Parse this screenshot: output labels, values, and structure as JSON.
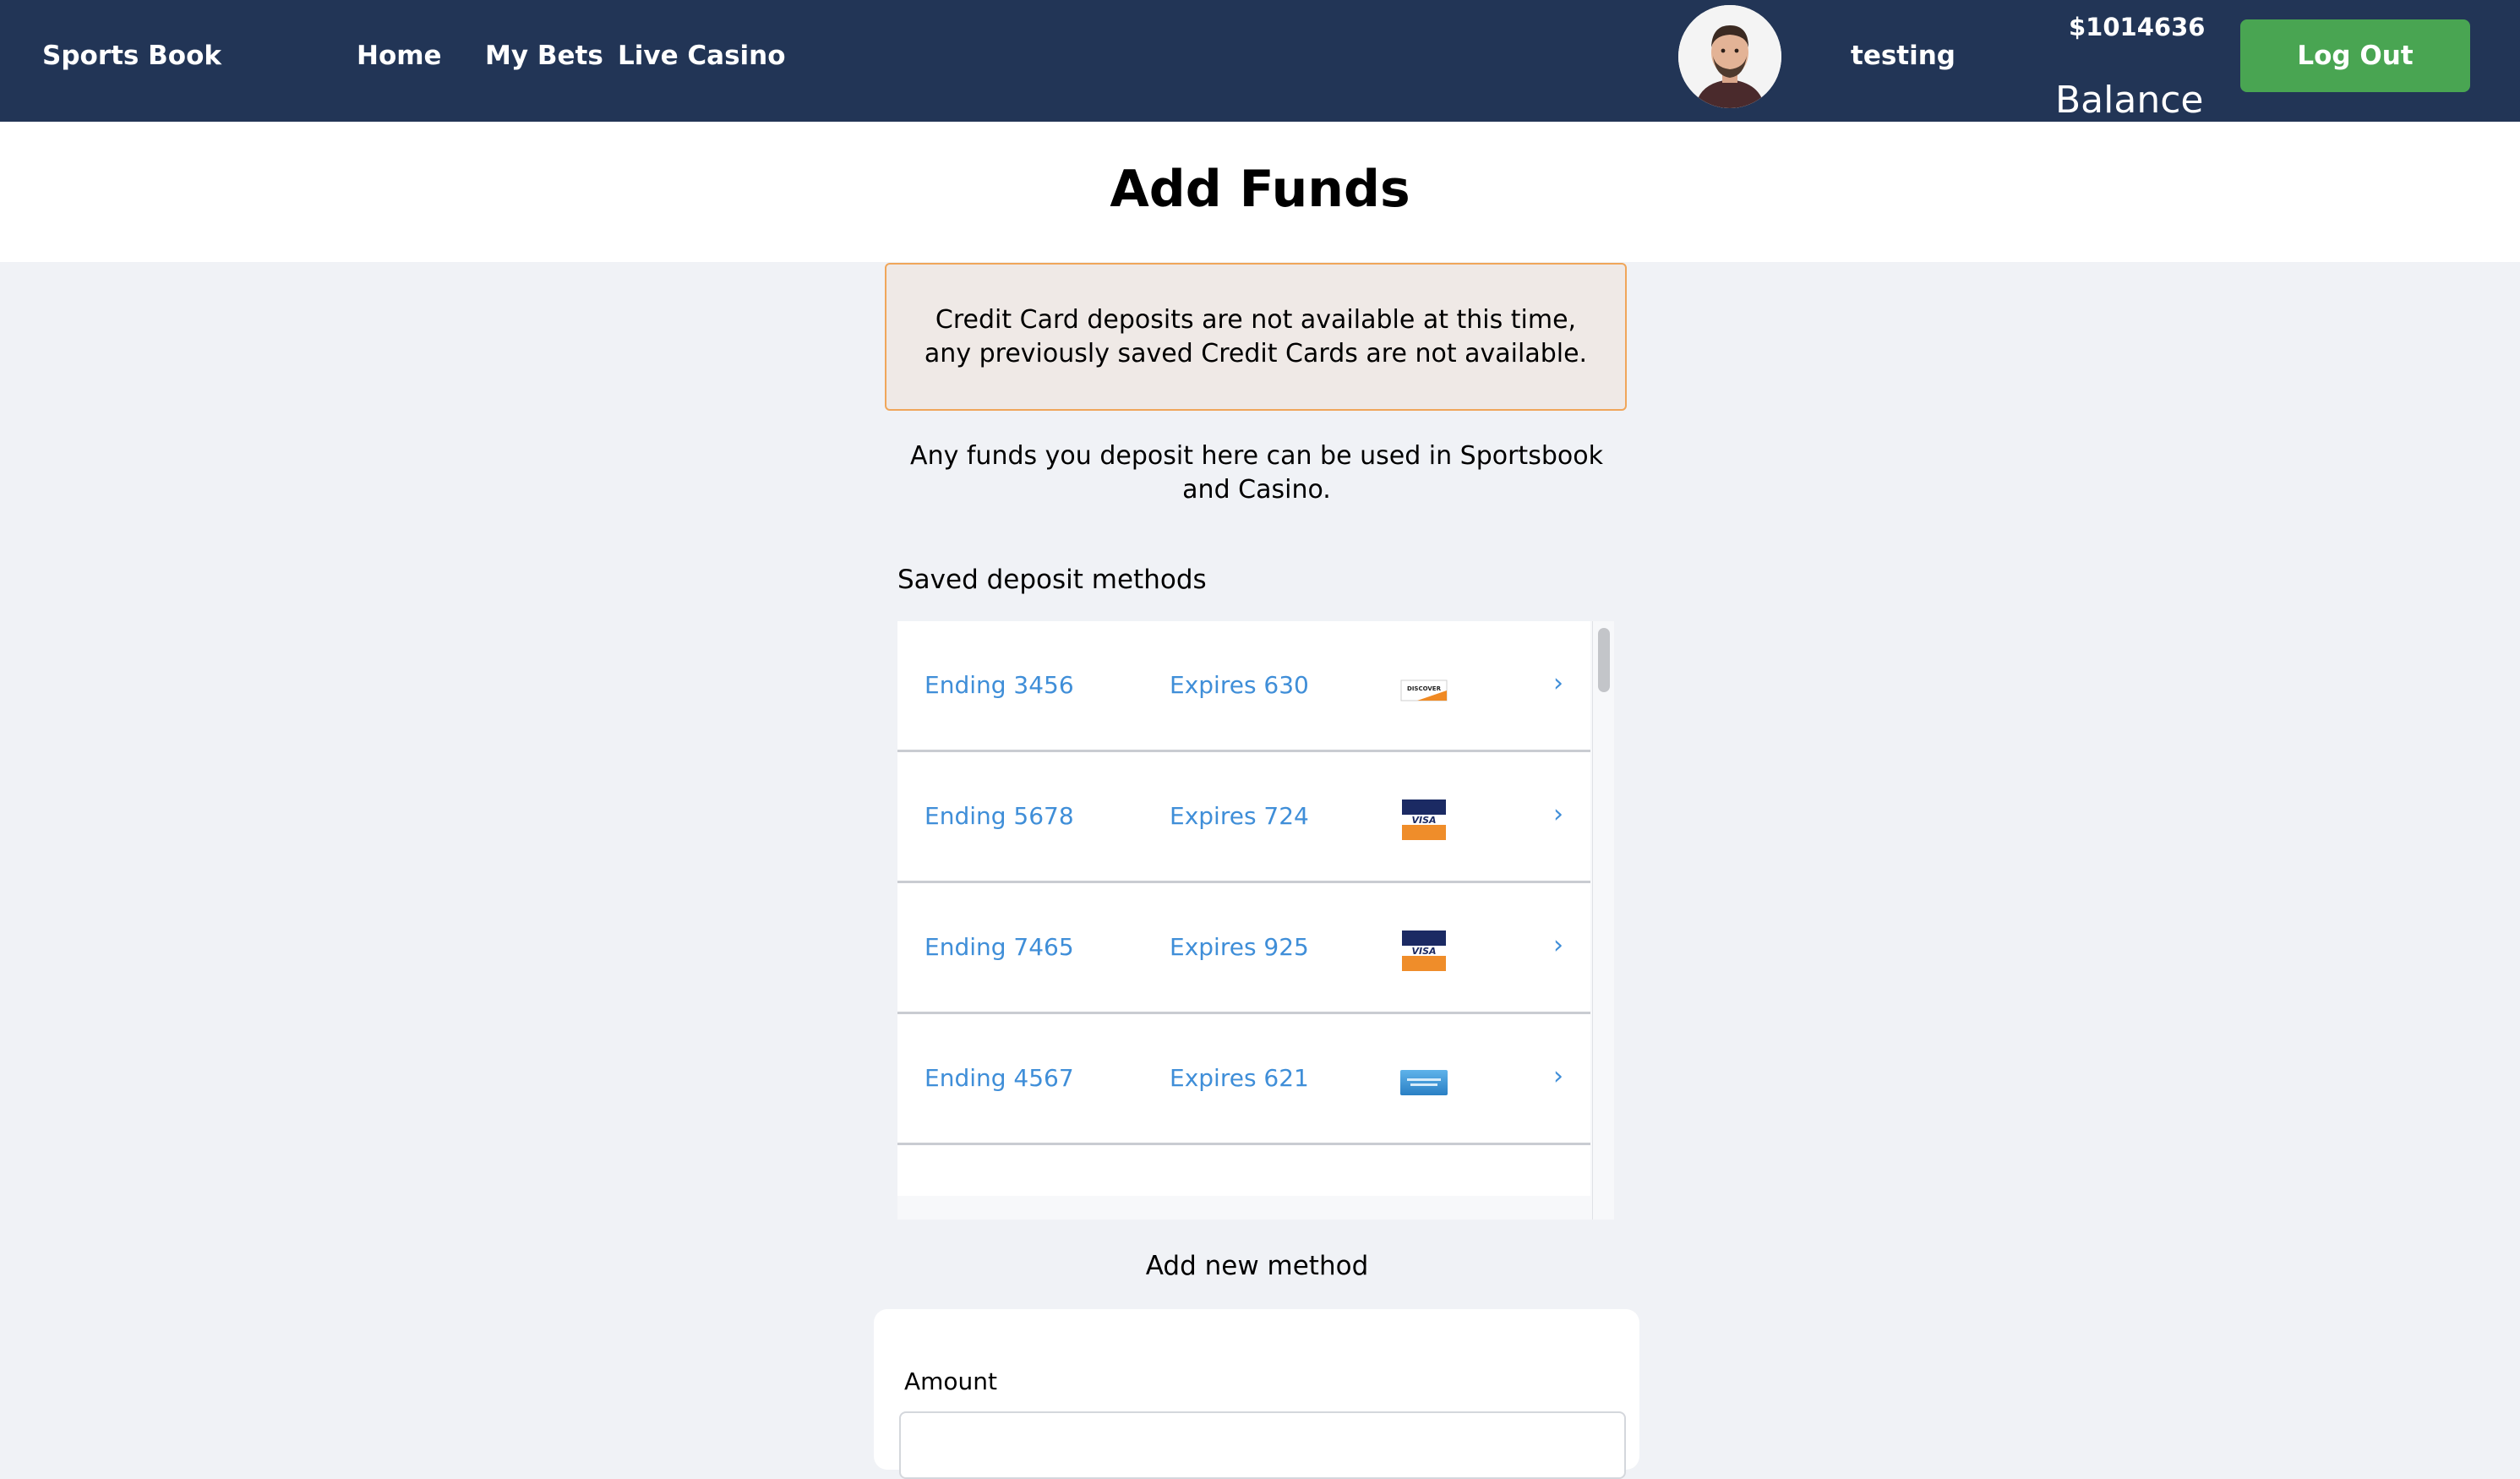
{
  "header": {
    "brand": "Sports Book",
    "nav": [
      "Home",
      "My Bets",
      "Live Casino"
    ],
    "username": "testing",
    "balance_amount": "$1014636",
    "balance_label": "Balance",
    "logout_label": "Log Out"
  },
  "page": {
    "title": "Add Funds",
    "alert": "Credit Card deposits are not available at this time, any previously saved Credit Cards are not available.",
    "info": "Any funds you deposit here can be used in Sportsbook and Casino.",
    "saved_heading": "Saved deposit methods",
    "add_new_label": "Add new method"
  },
  "saved_methods": [
    {
      "ending": "Ending 3456",
      "expires": "Expires 630",
      "card": "discover-card-icon"
    },
    {
      "ending": "Ending 5678",
      "expires": "Expires 724",
      "card": "visa-card-icon"
    },
    {
      "ending": "Ending 7465",
      "expires": "Expires 925",
      "card": "visa-card-icon"
    },
    {
      "ending": "Ending 4567",
      "expires": "Expires 621",
      "card": "amex-card-icon"
    }
  ],
  "chevron": "›",
  "form": {
    "amount_label": "Amount",
    "amount_value": ""
  },
  "colors": {
    "header_bg": "#223556",
    "logout_bg": "#49a552",
    "link": "#3f8ed8",
    "alert_border": "#f0a65a",
    "alert_bg": "#efe9e6"
  }
}
